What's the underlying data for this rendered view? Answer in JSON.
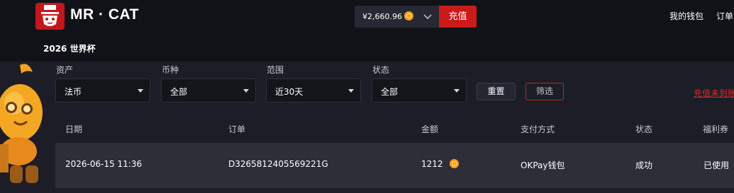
{
  "header": {
    "brand": "MR · CAT",
    "subnav_item": "2026 世界杯",
    "balance": "¥2,660.96",
    "recharge_label": "充值",
    "nav_links": [
      "我的钱包",
      "订单"
    ]
  },
  "filters": {
    "fields": [
      {
        "label": "资产",
        "value": "法币"
      },
      {
        "label": "币种",
        "value": "全部"
      },
      {
        "label": "范围",
        "value": "近30天"
      },
      {
        "label": "状态",
        "value": "全部"
      }
    ],
    "reset_label": "重置",
    "filter_label": "筛选",
    "unpaid_link": "充值未到账"
  },
  "table": {
    "columns": [
      "日期",
      "订单",
      "金额",
      "支付方式",
      "状态",
      "福利券"
    ],
    "rows": [
      {
        "date": "2026-06-15 11:36",
        "order": "D3265812405569221G",
        "amount": "1212",
        "payment": "OKPay钱包",
        "status": "成功",
        "coupon": "已使用"
      }
    ]
  },
  "colors": {
    "accent_red": "#cb1a1a",
    "coin_gold": "#f5a21b",
    "page_bg": "#1c1d26",
    "header_bg": "#111217",
    "row_bg": "#2d2e38"
  },
  "icons": [
    "logo-mascot-icon",
    "coin-icon",
    "chevron-down-icon",
    "caret-down-icon"
  ]
}
